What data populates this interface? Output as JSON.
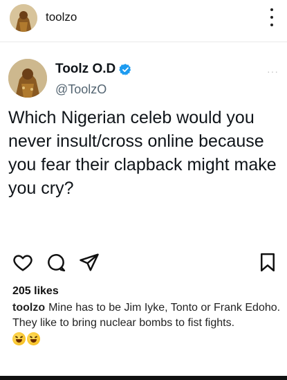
{
  "post": {
    "username": "toolzo",
    "likes": "205 likes",
    "caption_user": "toolzo",
    "caption_line1": "Mine has to be Jim Iyke, Tonto or Frank Edoho.",
    "caption_line2": "They like to bring nuclear bombs to fist fights."
  },
  "tweet": {
    "display_name": "Toolz O.D",
    "handle": "@ToolzO",
    "text": "Which Nigerian celeb would you never insult/cross online because you fear their clapback might make you cry?",
    "verified_color": "#1d9bf0"
  },
  "icons": {
    "more": "more-vertical-icon",
    "like": "heart-icon",
    "comment": "comment-bubble-icon",
    "share": "send-icon",
    "save": "bookmark-icon",
    "emoji": "rolling-laughing-emoji"
  }
}
